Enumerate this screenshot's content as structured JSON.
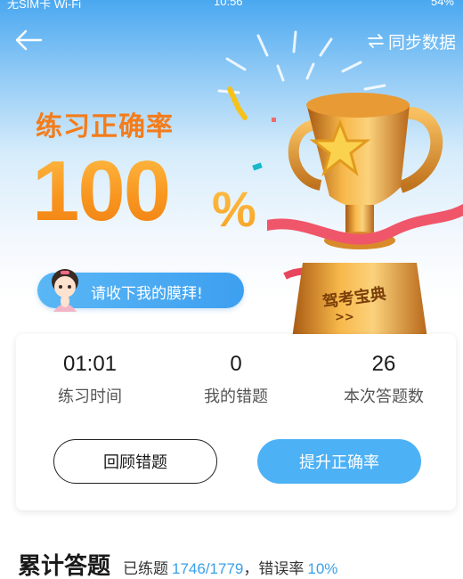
{
  "status_bar": {
    "left": "无SIM卡 Wi-Fi",
    "center": "10:56",
    "right": "54%"
  },
  "header": {
    "sync_label": "同步数据"
  },
  "hero": {
    "title": "练习正确率",
    "percent_number": "100",
    "percent_sign": "%",
    "pill_text": "请收下我的膜拜!",
    "trophy_text": "驾考宝典",
    "trophy_arrows": ">>"
  },
  "stats": [
    {
      "value": "01:01",
      "label": "练习时间"
    },
    {
      "value": "0",
      "label": "我的错题"
    },
    {
      "value": "26",
      "label": "本次答题数"
    }
  ],
  "buttons": {
    "review": "回顾错题",
    "improve": "提升正确率"
  },
  "summary": {
    "heading": "累计答题",
    "practiced_label": "已练题",
    "practiced_value": "1746/1779",
    "separator": "，",
    "error_label": "错误率",
    "error_value": "10%"
  },
  "colors": {
    "accent_orange": "#f7931e",
    "accent_blue": "#4db1f5"
  }
}
